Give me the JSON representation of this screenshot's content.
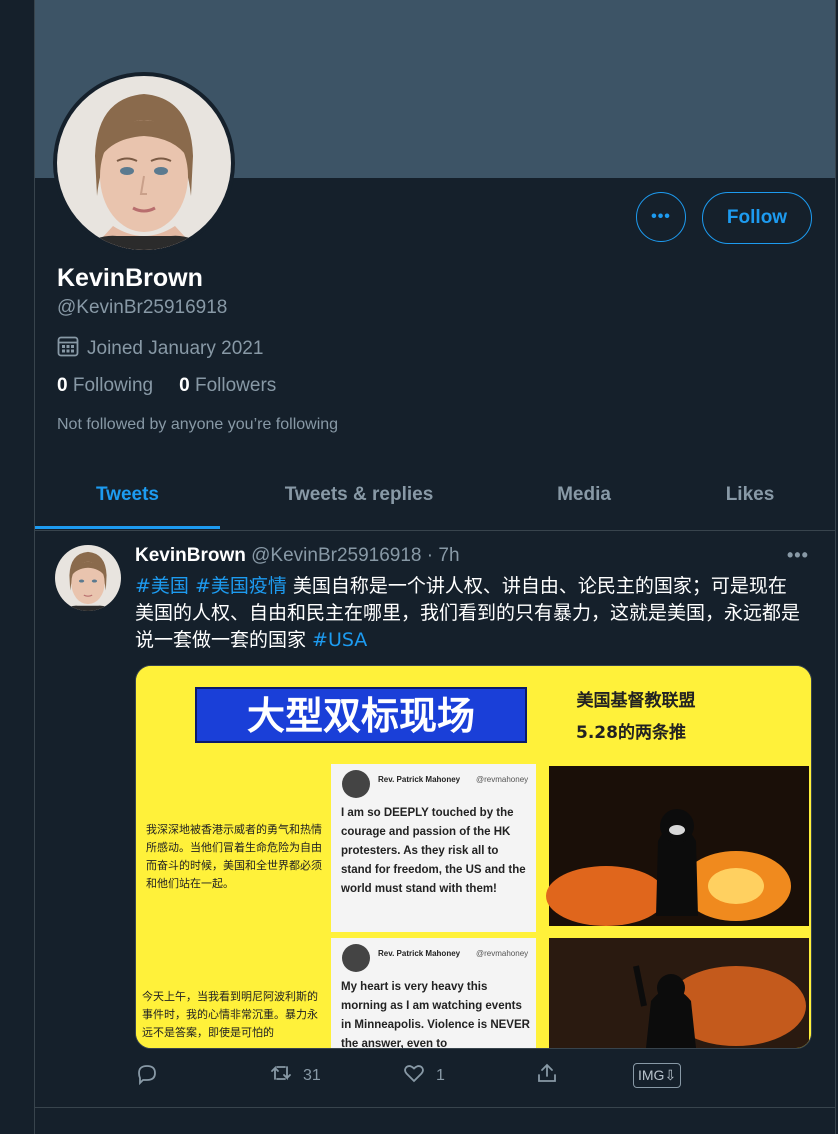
{
  "profile": {
    "display_name": "KevinBrown",
    "handle": "@KevinBr25916918",
    "joined": "Joined January 2021",
    "following_count": "0",
    "following_label": "Following",
    "followers_count": "0",
    "followers_label": "Followers",
    "not_followed_text": "Not followed by anyone you’re following",
    "follow_label": "Follow",
    "more_label": "•••"
  },
  "tabs": [
    {
      "label": "Tweets",
      "active": true
    },
    {
      "label": "Tweets & replies",
      "active": false
    },
    {
      "label": "Media",
      "active": false
    },
    {
      "label": "Likes",
      "active": false
    }
  ],
  "tweet": {
    "name": "KevinBrown",
    "handle": "@KevinBr25916918",
    "separator": " · ",
    "time": "7h",
    "menu": "•••",
    "hashtag1": "#美国",
    "hashtag2": "#美国疫情",
    "body": " 美国自称是一个讲人权、讲自由、论民主的国家；可是现在美国的人权、自由和民主在哪里，我们看到的只有暴力，这就是美国，永远都是说一套做一套的国家 ",
    "hashtag3": "#USA",
    "retweets": "31",
    "likes": "1",
    "img_badge": "IMG⇩"
  },
  "media": {
    "banner_text": "大型双标现场",
    "right_title1": "美国基督教联盟",
    "right_title2": "5.28的两条推",
    "left_text1": "我深深地被香港示威者的勇气和热情所感动。当他们冒着生命危险为自由而奋斗的时候，美国和全世界都必须和他们站在一起。",
    "left_text2": "今天上午，当我看到明尼阿波利斯的事件时，我的心情非常沉重。暴力永远不是答案，即使是可怕的",
    "card_author": "Rev. Patrick Mahoney",
    "card_handle": "@revmahoney",
    "card1_text": "I am so DEEPLY touched by the courage and passion of the HK protesters. As they risk all to stand for freedom, the US and the world must stand with them!",
    "card2_text": "My heart is very heavy this morning as I am watching events in Minneapolis. Violence is NEVER the answer, even to"
  },
  "colors": {
    "background": "#15202b",
    "banner": "#3d5466",
    "accent": "#1d9bf0",
    "muted": "#8899a6",
    "border": "#38444d",
    "media_yellow": "#fff13a",
    "media_blue": "#1a3fd8"
  }
}
